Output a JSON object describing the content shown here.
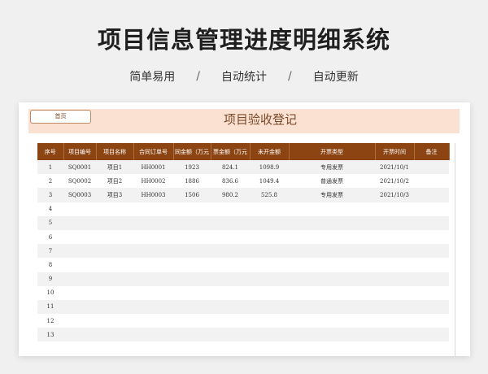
{
  "header": {
    "title": "项目信息管理进度明细系统",
    "features": [
      "简单易用",
      "自动统计",
      "自动更新"
    ],
    "separator": "/"
  },
  "sheet": {
    "home_button": "首页",
    "title": "项目验收登记",
    "columns": [
      "序号",
      "项目编号",
      "项目名称",
      "合同订单号",
      "同金额（万元",
      "票金额（万元",
      "未开金额",
      "开票类型",
      "开票时间",
      "备注"
    ],
    "rows": [
      [
        "1",
        "SQ0001",
        "项目1",
        "HH0001",
        "1923",
        "824.1",
        "1098.9",
        "专用发票",
        "2021/10/1",
        ""
      ],
      [
        "2",
        "SQ0002",
        "项目2",
        "HH0002",
        "1886",
        "836.6",
        "1049.4",
        "普通发票",
        "2021/10/2",
        ""
      ],
      [
        "3",
        "SQ0003",
        "项目3",
        "HH0003",
        "1506",
        "980.2",
        "525.8",
        "专用发票",
        "2021/10/3",
        ""
      ],
      [
        "4",
        "",
        "",
        "",
        "",
        "",
        "",
        "",
        "",
        ""
      ],
      [
        "5",
        "",
        "",
        "",
        "",
        "",
        "",
        "",
        "",
        ""
      ],
      [
        "6",
        "",
        "",
        "",
        "",
        "",
        "",
        "",
        "",
        ""
      ],
      [
        "7",
        "",
        "",
        "",
        "",
        "",
        "",
        "",
        "",
        ""
      ],
      [
        "8",
        "",
        "",
        "",
        "",
        "",
        "",
        "",
        "",
        ""
      ],
      [
        "9",
        "",
        "",
        "",
        "",
        "",
        "",
        "",
        "",
        ""
      ],
      [
        "10",
        "",
        "",
        "",
        "",
        "",
        "",
        "",
        "",
        ""
      ],
      [
        "11",
        "",
        "",
        "",
        "",
        "",
        "",
        "",
        "",
        ""
      ],
      [
        "12",
        "",
        "",
        "",
        "",
        "",
        "",
        "",
        "",
        ""
      ],
      [
        "13",
        "",
        "",
        "",
        "",
        "",
        "",
        "",
        "",
        ""
      ]
    ]
  },
  "colors": {
    "header_fill": "#8c4512",
    "title_band": "#fbe1d2",
    "title_text": "#7a4a2a"
  }
}
